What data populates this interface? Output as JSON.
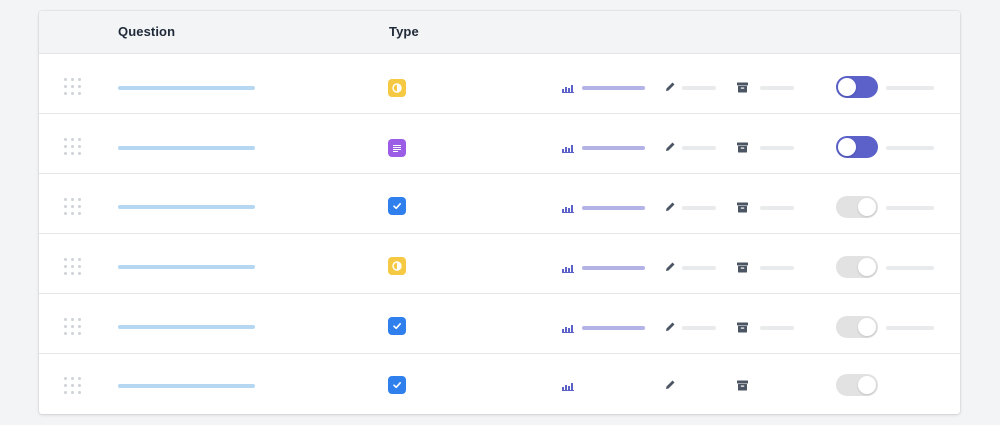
{
  "header": {
    "question_label": "Question",
    "type_label": "Type"
  },
  "colors": {
    "rating_type": "#f6c945",
    "text_type": "#9b5de5",
    "checkbox_type": "#2f80ed",
    "toggle_on": "#5b61c9",
    "toggle_off": "#e2e2e2",
    "question_placeholder": "#b5d7f2",
    "stats_placeholder": "#b3b3e6"
  },
  "rows": [
    {
      "type": "rating",
      "type_icon": "half-circle-icon",
      "enabled": true
    },
    {
      "type": "text",
      "type_icon": "lines-icon",
      "enabled": true
    },
    {
      "type": "checkbox",
      "type_icon": "checkmark-icon",
      "enabled": false
    },
    {
      "type": "rating",
      "type_icon": "half-circle-icon",
      "enabled": false
    },
    {
      "type": "checkbox",
      "type_icon": "checkmark-icon",
      "enabled": false
    },
    {
      "type": "checkbox",
      "type_icon": "checkmark-icon",
      "enabled": false
    }
  ]
}
